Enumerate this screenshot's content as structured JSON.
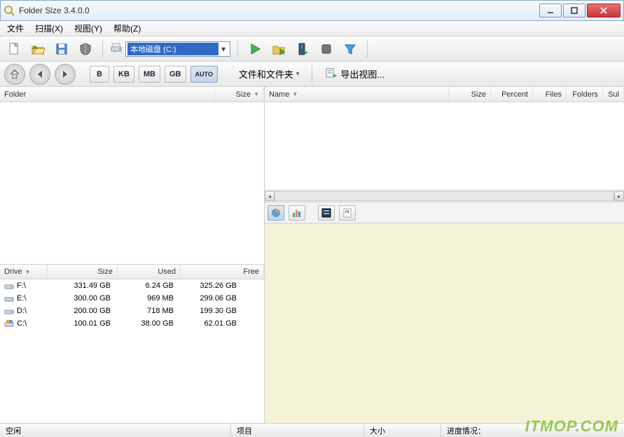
{
  "window": {
    "title": "Folder Size 3.4.0.0"
  },
  "menu": {
    "file": "文件",
    "scan": "扫描(X)",
    "view": "视图(Y)",
    "help": "帮助(Z)"
  },
  "toolbar": {
    "drive_prefix_icon": "drive-icon",
    "drive_selected": "本地磁盘 (C:)"
  },
  "toolbar2": {
    "unit_b": "B",
    "unit_kb": "KB",
    "unit_mb": "MB",
    "unit_gb": "GB",
    "unit_auto": "AUTO",
    "files_folders": "文件和文件夹",
    "export_view": "导出视图..."
  },
  "folder_cols": {
    "folder": "Folder",
    "size": "Size"
  },
  "file_cols": {
    "name": "Name",
    "size": "Size",
    "percent": "Percent",
    "files": "Files",
    "folders": "Folders",
    "sub": "Sul"
  },
  "drive_cols": {
    "drive": "Drive",
    "size": "Size",
    "used": "Used",
    "free": "Free"
  },
  "drives": [
    {
      "name": "F:\\",
      "size": "331.49 GB",
      "used": "6.24 GB",
      "free": "325.26 GB",
      "type": "hdd"
    },
    {
      "name": "E:\\",
      "size": "300.00 GB",
      "used": "969 MB",
      "free": "299.06 GB",
      "type": "hdd"
    },
    {
      "name": "D:\\",
      "size": "200.00 GB",
      "used": "718 MB",
      "free": "199.30 GB",
      "type": "hdd"
    },
    {
      "name": "C:\\",
      "size": "100.01 GB",
      "used": "38.00 GB",
      "free": "62.01 GB",
      "type": "sys"
    }
  ],
  "status": {
    "idle": "空闲",
    "items": "项目",
    "size": "大小",
    "progress": "进度情况："
  },
  "watermark": "ITMOP.COM"
}
